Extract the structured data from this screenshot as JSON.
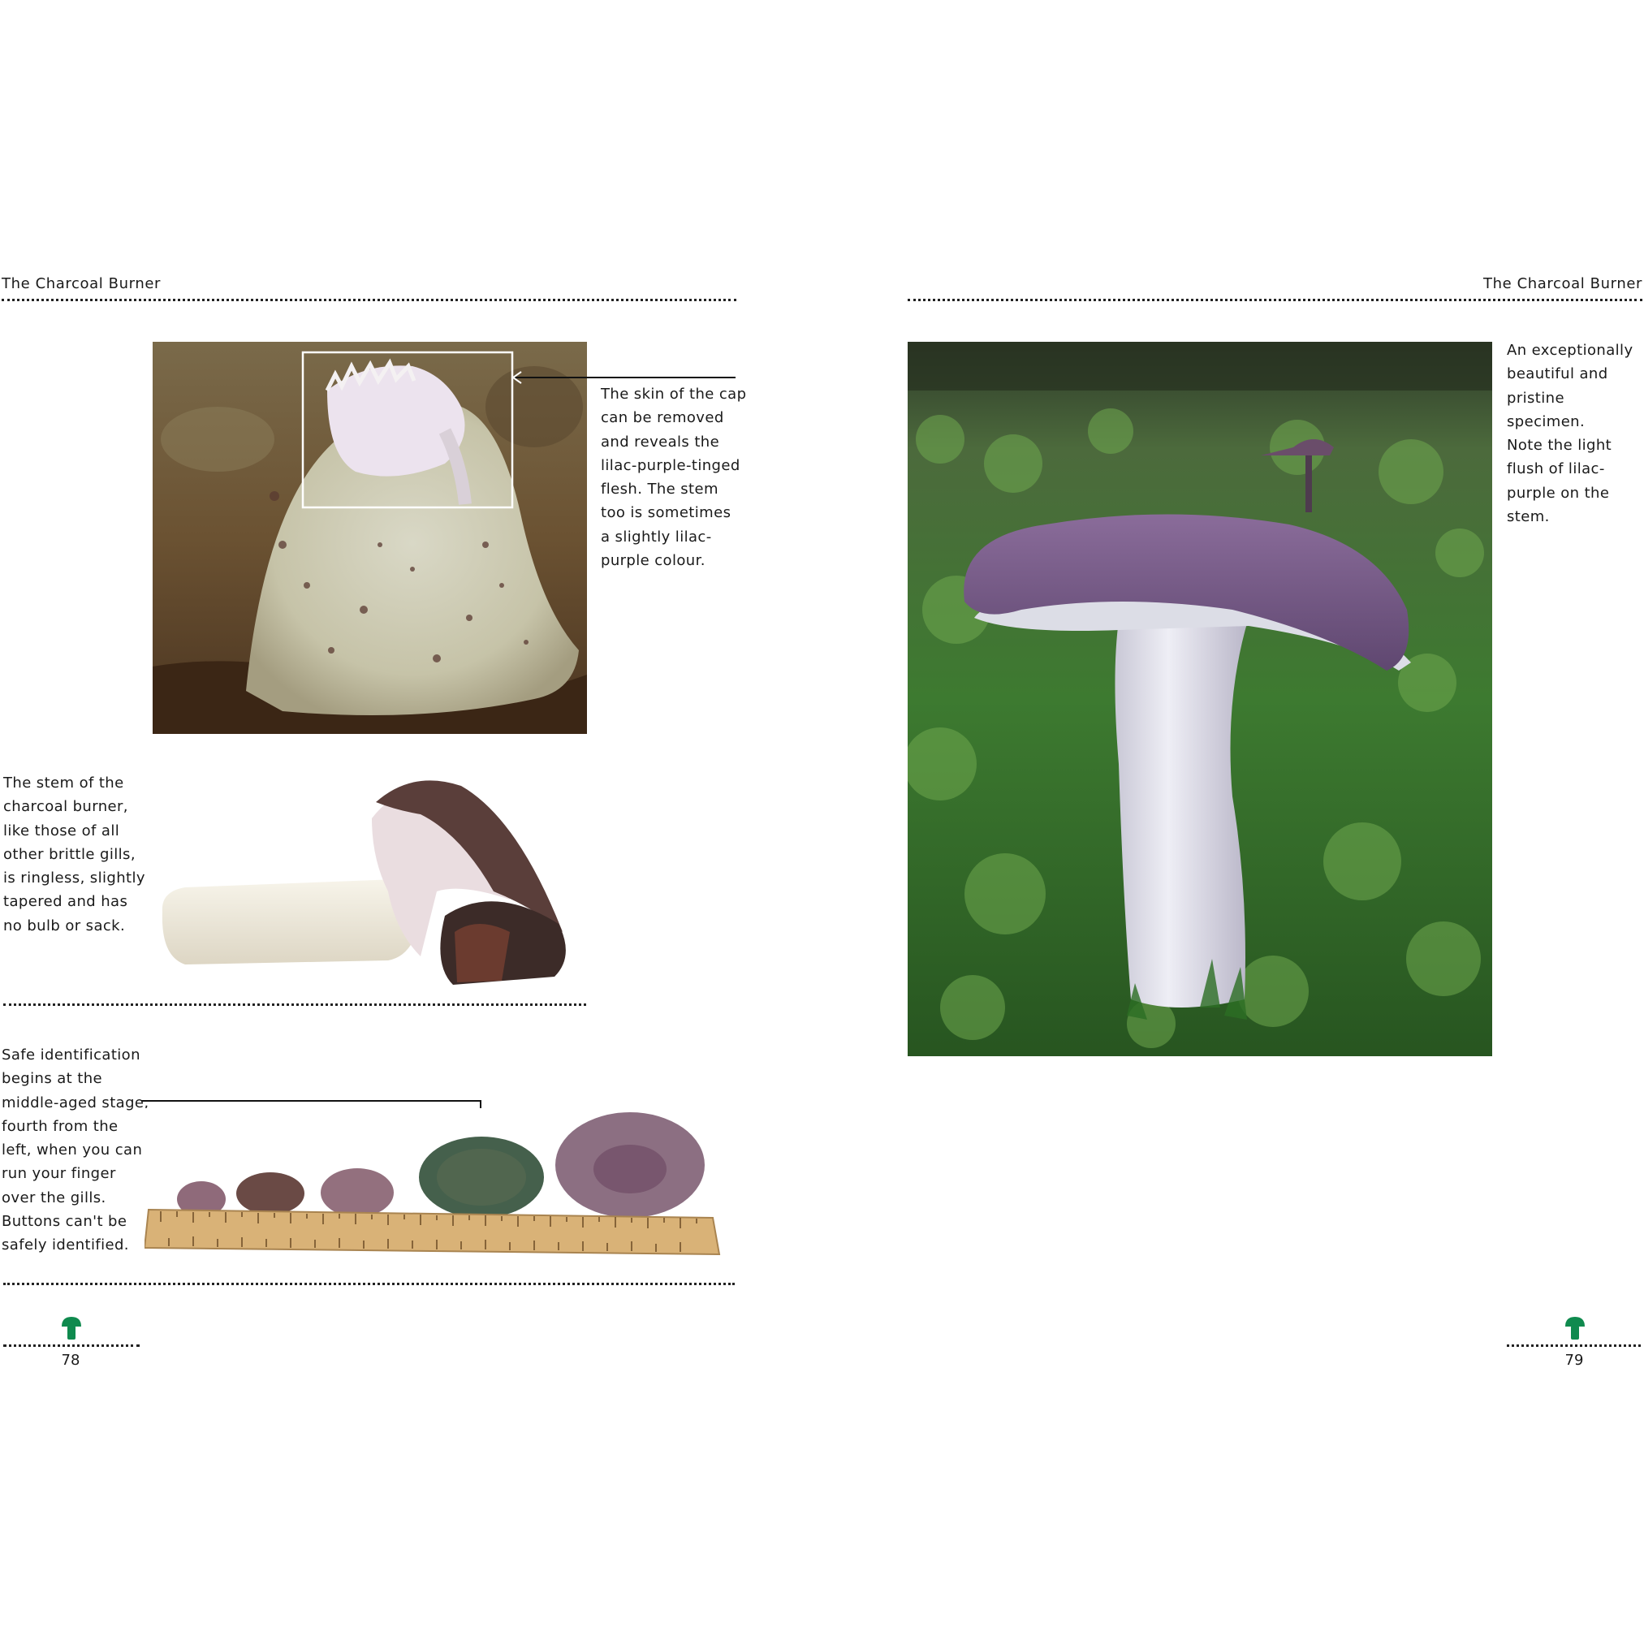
{
  "left_page": {
    "running_header": "The Charcoal Burner",
    "captions": {
      "cap_skin": "The skin of the cap\ncan be removed\nand reveals the\nlilac-purple-tinged\nflesh. The stem\ntoo is sometimes\na slightly lilac-\npurple colour.",
      "stem": "The stem of the\ncharcoal burner,\nlike those of all\nother brittle gills,\nis ringless, slightly\ntapered and has\nno bulb or sack.",
      "identification": "Safe identification\nbegins at the\nmiddle-aged stage,\nfourth from the\nleft, when you can\nrun your finger\nover the gills.\nButtons can't be\nsafely identified."
    },
    "page_number": "78"
  },
  "right_page": {
    "running_header": "The Charcoal Burner",
    "caption": "An exceptionally\nbeautiful and\npristine specimen.\nNote the light\nflush of lilac-\npurple on the\nstem.",
    "page_number": "79"
  },
  "icons": [
    "mushroom-icon",
    "arrow-left-icon",
    "arrow-down-icon"
  ],
  "colors": {
    "accent_green": "#0f8a4e",
    "cap_purple": "#7a5a8c",
    "moss_green": "#3f7a33",
    "ruler_wood": "#d9b277"
  }
}
